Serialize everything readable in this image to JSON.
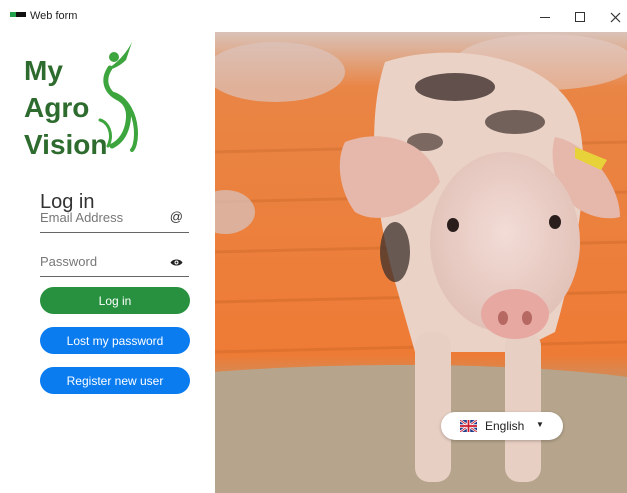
{
  "window": {
    "title": "Web form",
    "minimize": "–",
    "maximize": "☐",
    "close": "×"
  },
  "logo": {
    "line1": "My",
    "line2": "Agro",
    "line3": "Vision"
  },
  "login": {
    "title": "Log in",
    "email_placeholder": "Email Address",
    "email_icon": "@",
    "password_placeholder": "Password",
    "password_icon": "eye-icon",
    "login_button": "Log in",
    "lost_password_button": "Lost my password",
    "register_button": "Register new user"
  },
  "language": {
    "selected": "English",
    "flag_icon": "uk-flag-icon",
    "caret_icon": "caret-down-icon"
  },
  "colors": {
    "logo_green": "#2e6b2e",
    "login_button": "#27913f",
    "blue_button": "#0a7cf0"
  }
}
